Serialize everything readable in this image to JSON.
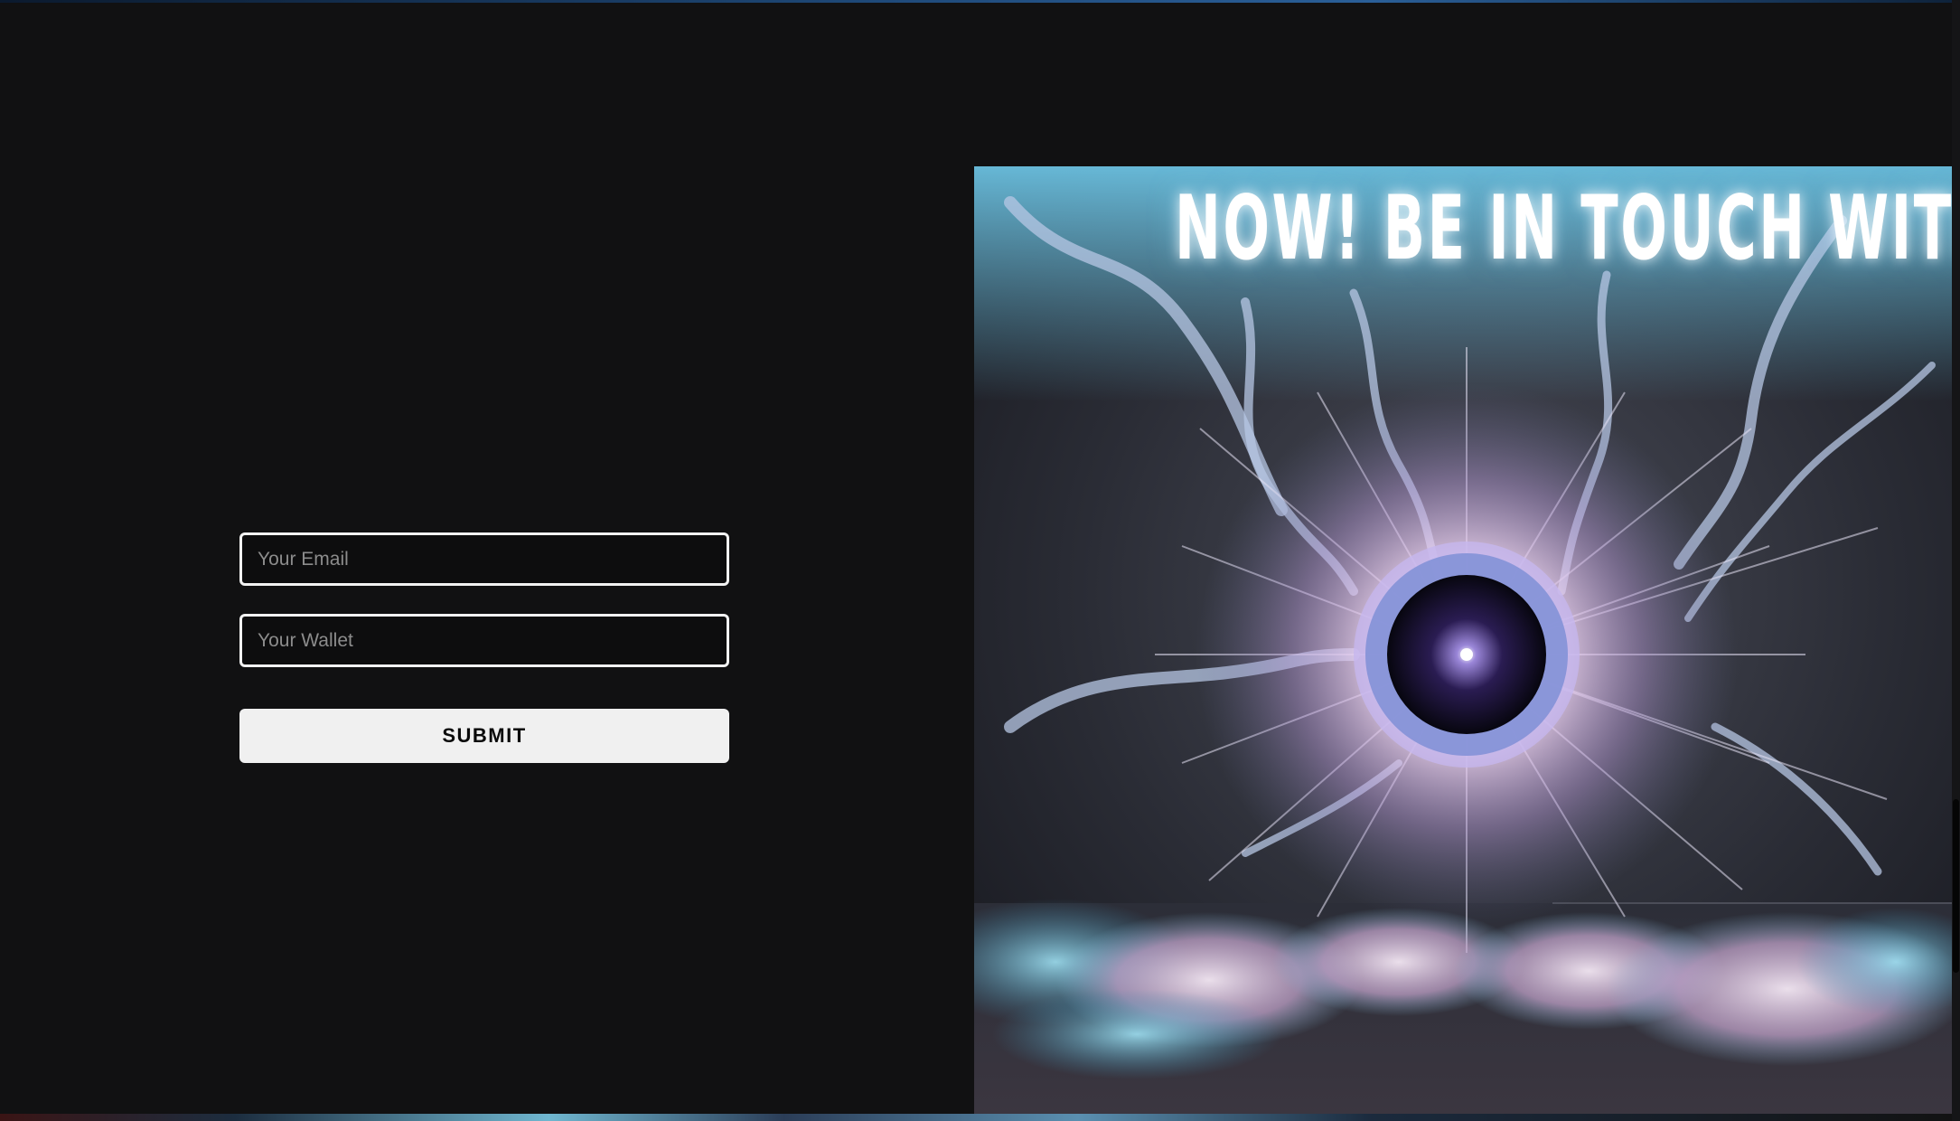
{
  "form": {
    "email_placeholder": "Your Email",
    "wallet_placeholder": "Your Wallet",
    "submit_label": "SUBMIT"
  },
  "artwork": {
    "headline": "NOW! BE IN TOUCH WITH US"
  },
  "colors": {
    "page_background": "#111112",
    "field_border": "#f2f2f2",
    "button_background": "#f0f0f0",
    "button_text": "#0a0a0a",
    "glow_accent": "#8cdcff"
  }
}
